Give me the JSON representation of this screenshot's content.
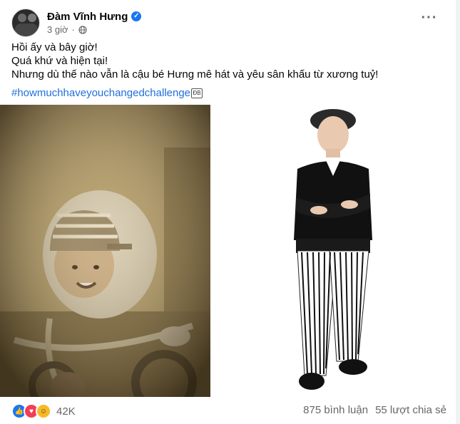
{
  "post": {
    "author": "Đàm Vĩnh Hưng",
    "time": "3 giờ",
    "lines": [
      "Hồi ấy và bây giờ!",
      "Quá khứ và hiện tại!",
      "Nhưng dù thế nào vẫn là cậu bé Hưng mê hát và yêu sân khấu từ xương tuỷ!"
    ],
    "hashtag": "#howmuchhaveyouchangedchallenge",
    "tag_icon_text": "ĐB"
  },
  "icons": {
    "verified": "verified-badge-icon",
    "privacy": "globe-icon",
    "more": "more-options-icon",
    "like": "like-reaction-icon",
    "love": "love-reaction-icon",
    "haha": "haha-reaction-icon"
  },
  "footer": {
    "reaction_count": "42K",
    "comments": "875 bình luận",
    "shares": "55 lượt chia sẻ"
  },
  "colors": {
    "link": "#216fdb",
    "like": "#1877f2",
    "love": "#f33e58",
    "haha": "#f7b928",
    "muted": "#65676b"
  }
}
